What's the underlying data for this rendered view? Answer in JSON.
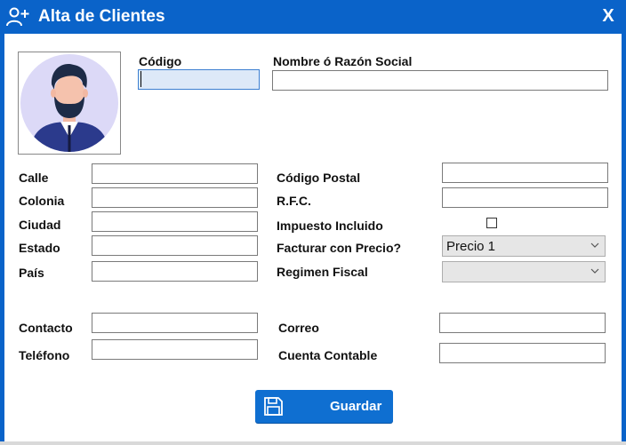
{
  "window": {
    "title": "Alta de Clientes",
    "close_label": "X",
    "title_icon": "add-user-icon"
  },
  "form": {
    "codigo_label": "Código",
    "codigo_value": "",
    "nombre_label": "Nombre ó Razón Social",
    "nombre_value": "",
    "calle_label": "Calle",
    "colonia_label": "Colonia",
    "ciudad_label": "Ciudad",
    "estado_label": "Estado",
    "pais_label": "País",
    "codigo_postal_label": "Código Postal",
    "rfc_label": "R.F.C.",
    "impuesto_label": "Impuesto Incluido",
    "impuesto_checked": false,
    "facturar_label": "Facturar con Precio?",
    "facturar_value": "Precio 1",
    "regimen_label": "Regimen Fiscal",
    "regimen_value": "",
    "contacto_label": "Contacto",
    "telefono_label": "Teléfono",
    "correo_label": "Correo",
    "cuenta_label": "Cuenta Contable"
  },
  "actions": {
    "save_label": "Guardar",
    "save_icon": "floppy-disk-icon"
  },
  "colors": {
    "titlebar": "#0a63c9",
    "button": "#0f6fd1",
    "avatar_bg": "#dcd9f7",
    "avatar_shirt": "#2b3a8c",
    "avatar_hair": "#1d2b47"
  }
}
